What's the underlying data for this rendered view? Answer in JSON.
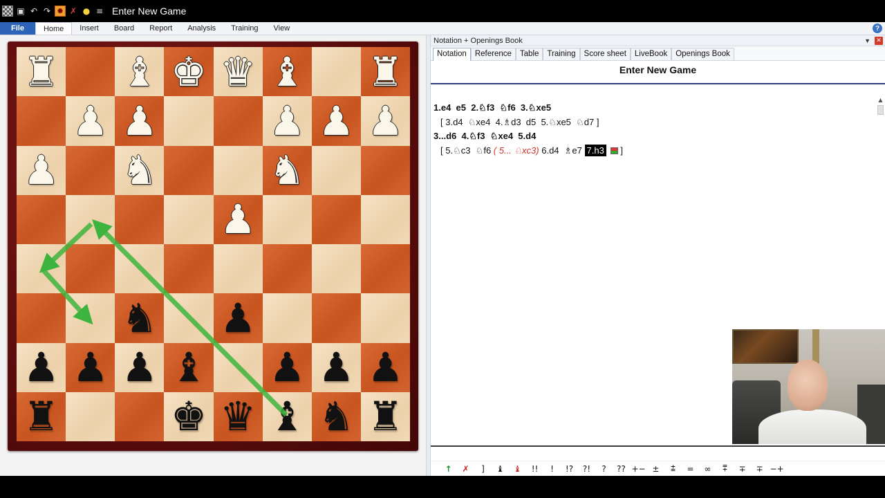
{
  "window": {
    "title": "Enter New Game",
    "quick_access": [
      "app-icon",
      "save-icon",
      "undo-icon",
      "redo-icon",
      "engine-icon",
      "close-engine-icon",
      "lightbulb-icon",
      "more-icon"
    ]
  },
  "ribbon": {
    "tabs": [
      "File",
      "Home",
      "Insert",
      "Board",
      "Report",
      "Analysis",
      "Training",
      "View"
    ],
    "active": "Home",
    "help": "?"
  },
  "board": {
    "ranks": [
      [
        "wR",
        "",
        "wB",
        "wK",
        "wQ",
        "wB",
        "",
        "wR"
      ],
      [
        "",
        "wP",
        "wP",
        "",
        "",
        "wP",
        "wP",
        "wP"
      ],
      [
        "wP",
        "",
        "wN",
        "",
        "",
        "wN",
        "",
        ""
      ],
      [
        "",
        "",
        "",
        "",
        "wP",
        "",
        "",
        ""
      ],
      [
        "",
        "",
        "",
        "",
        "",
        "",
        "",
        ""
      ],
      [
        "",
        "",
        "bN",
        "",
        "bP",
        "",
        "",
        ""
      ],
      [
        "bP",
        "bP",
        "bP",
        "bB",
        "",
        "bP",
        "bP",
        "bP"
      ],
      [
        "bR",
        "",
        "",
        "bK",
        "bQ",
        "bB",
        "bN",
        "bR"
      ]
    ],
    "arrow_color": "#3db43d"
  },
  "panel": {
    "header": "Notation + Openings Book",
    "header_dropdown": "▼",
    "header_close": "✕",
    "tabs": [
      "Notation",
      "Reference",
      "Table",
      "Training",
      "Score sheet",
      "LiveBook",
      "Openings Book"
    ],
    "active_tab": "Notation",
    "game_title": "Enter New Game",
    "notation": {
      "line1": "1.e4  e5  2.♘f3  ♘f6  3.♘xe5",
      "line2": "[ 3.d4  ♘xe4  4.♗d3  d5  5.♘xe5  ♘d7 ]",
      "line3": "3...d6  4.♘f3  ♘xe4  5.d4",
      "line4_pre": "[ 5.♘c3  ♘f6 ",
      "line4_sub": "( 5... ♘xc3)",
      "line4_mid": " 6.d4  ♗e7 ",
      "line4_current": "7.h3",
      "line4_post": " ]"
    },
    "annotations": [
      "↑",
      "✗",
      "]",
      "♝",
      "♝",
      "!!",
      "!",
      "!?",
      "?!",
      "?",
      "??",
      "+−",
      "±",
      "⩲",
      "=",
      "∞",
      "⩱",
      "∓",
      "∓",
      "−+"
    ]
  }
}
